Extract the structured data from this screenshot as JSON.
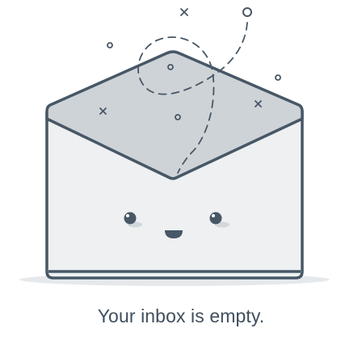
{
  "empty_state": {
    "message": "Your inbox is empty.",
    "illustration_icon": "open-envelope-smiling-icon"
  },
  "colors": {
    "background": "#ffffff",
    "outline": "#475766",
    "envelope_body": "#eef0f1",
    "envelope_flap": "#ced3d7",
    "shadow": "#e6e9ec",
    "cheek": "#d3d8dc",
    "text": "#3f4f5e"
  }
}
